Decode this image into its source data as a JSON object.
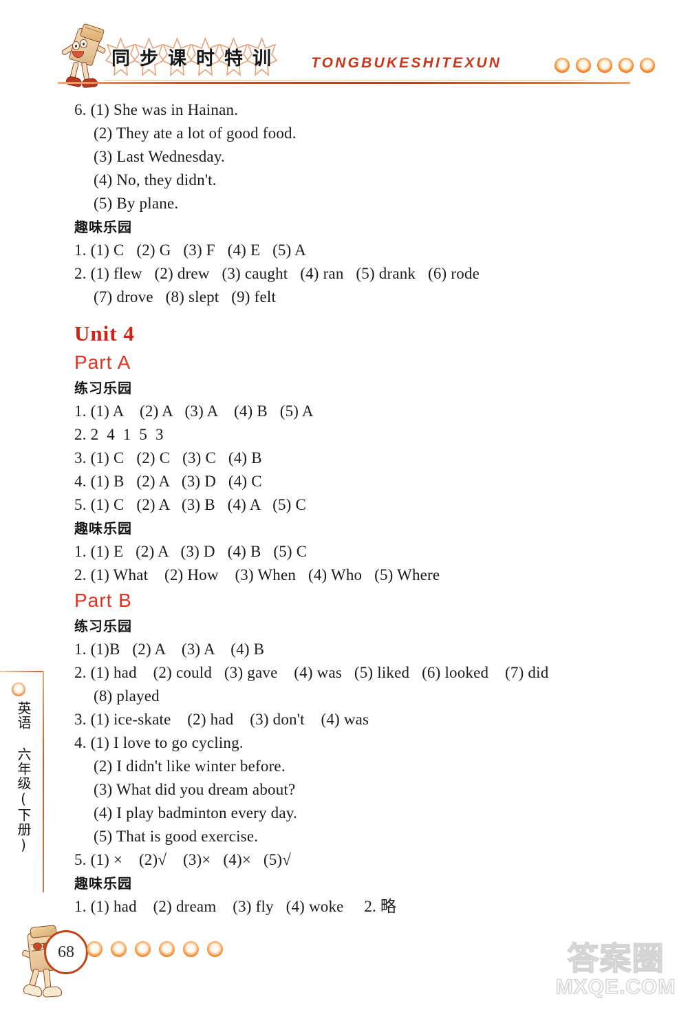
{
  "header": {
    "title_chars": [
      "同",
      "步",
      "课",
      "时",
      "特",
      "训"
    ],
    "pinyin": "TONGBUKESHITEXUN",
    "dot_count": 5,
    "accent_color": "#c8371b"
  },
  "side_tab": {
    "label": "英语 六年级(下册)",
    "subject": "英语",
    "grade": "六年级(下册)"
  },
  "content": {
    "lines": [
      {
        "kind": "en",
        "text": "6. (1) She was in Hainan."
      },
      {
        "kind": "en-i",
        "text": "(2) They ate a lot of good food."
      },
      {
        "kind": "en-i",
        "text": "(3) Last Wednesday."
      },
      {
        "kind": "en-i",
        "text": "(4) No, they didn't."
      },
      {
        "kind": "en-i",
        "text": "(5) By plane."
      },
      {
        "kind": "cn",
        "text": "趣味乐园"
      },
      {
        "kind": "en",
        "text": "1. (1) C   (2) G   (3) F   (4) E   (5) A"
      },
      {
        "kind": "en",
        "text": "2. (1) flew   (2) drew   (3) caught   (4) ran   (5) drank   (6) rode"
      },
      {
        "kind": "en-i",
        "text": "(7) drove   (8) slept   (9) felt"
      },
      {
        "kind": "unit",
        "text": "Unit 4"
      },
      {
        "kind": "part",
        "text": "Part A"
      },
      {
        "kind": "cn",
        "text": "练习乐园"
      },
      {
        "kind": "en",
        "text": "1. (1) A    (2) A   (3) A    (4) B   (5) A"
      },
      {
        "kind": "en",
        "text": "2. 2  4  1  5  3"
      },
      {
        "kind": "en",
        "text": "3. (1) C   (2) C   (3) C   (4) B"
      },
      {
        "kind": "en",
        "text": "4. (1) B   (2) A   (3) D   (4) C"
      },
      {
        "kind": "en",
        "text": "5. (1) C   (2) A   (3) B   (4) A   (5) C"
      },
      {
        "kind": "cn",
        "text": "趣味乐园"
      },
      {
        "kind": "en",
        "text": "1. (1) E   (2) A   (3) D   (4) B   (5) C"
      },
      {
        "kind": "en",
        "text": "2. (1) What    (2) How    (3) When   (4) Who   (5) Where"
      },
      {
        "kind": "part",
        "text": "Part B"
      },
      {
        "kind": "cn",
        "text": "练习乐园"
      },
      {
        "kind": "en",
        "text": "1. (1)B   (2) A    (3) A    (4) B"
      },
      {
        "kind": "en",
        "text": "2. (1) had    (2) could   (3) gave    (4) was   (5) liked   (6) looked    (7) did"
      },
      {
        "kind": "en-i",
        "text": "(8) played"
      },
      {
        "kind": "en",
        "text": "3. (1) ice-skate    (2) had    (3) don't    (4) was"
      },
      {
        "kind": "en",
        "text": "4. (1) I love to go cycling."
      },
      {
        "kind": "en-i",
        "text": "(2) I didn't like winter before."
      },
      {
        "kind": "en-i",
        "text": "(3) What did you dream about?"
      },
      {
        "kind": "en-i",
        "text": "(4) I play badminton every day."
      },
      {
        "kind": "en-i",
        "text": "(5) That is good exercise."
      },
      {
        "kind": "en",
        "text": "5. (1) ×    (2)√    (3)×   (4)×   (5)√"
      },
      {
        "kind": "cn",
        "text": "趣味乐园"
      },
      {
        "kind": "en",
        "text": "1. (1) had    (2) dream    (3) fly   (4) woke     2. 略"
      }
    ]
  },
  "footer": {
    "page_number": "68",
    "dot_count": 6
  },
  "watermark": {
    "cn": "答案圈",
    "en": "MXQE.COM"
  }
}
